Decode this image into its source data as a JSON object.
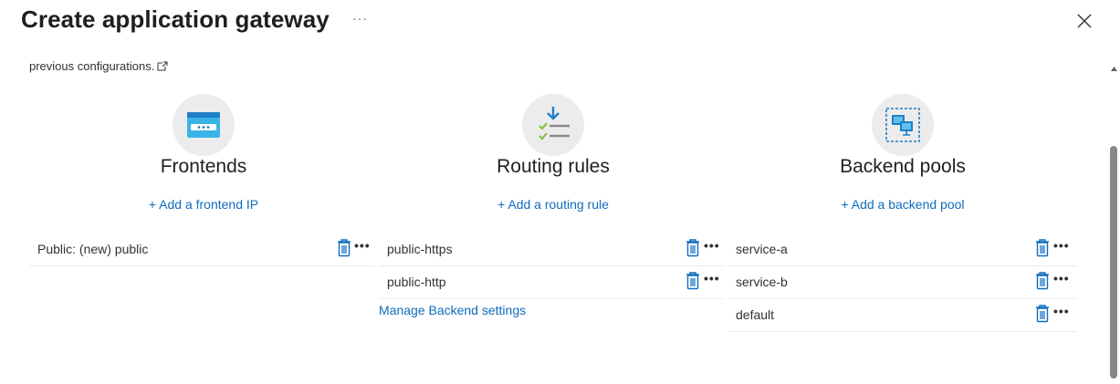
{
  "header": {
    "title": "Create application gateway",
    "more_label": "···",
    "close_icon": "close-icon"
  },
  "intro": {
    "text": "previous configurations."
  },
  "colors": {
    "link": "#0f6cbd",
    "trash": "#0f6cbd",
    "icon_circle": "#ececec"
  },
  "columns": {
    "frontends": {
      "title": "Frontends",
      "icon": "frontend-window-icon",
      "add_label": "+ Add a frontend IP",
      "rows": [
        {
          "label": "Public: (new) public"
        }
      ]
    },
    "routing": {
      "title": "Routing rules",
      "icon": "routing-rules-icon",
      "add_label": "+ Add a routing rule",
      "rows": [
        {
          "label": "public-https"
        },
        {
          "label": "public-http"
        }
      ],
      "manage_label": "Manage Backend settings"
    },
    "backend": {
      "title": "Backend pools",
      "icon": "backend-pool-icon",
      "add_label": "+ Add a backend pool",
      "rows": [
        {
          "label": "service-a"
        },
        {
          "label": "service-b"
        },
        {
          "label": "default"
        }
      ]
    }
  },
  "row_more_label": "•••"
}
